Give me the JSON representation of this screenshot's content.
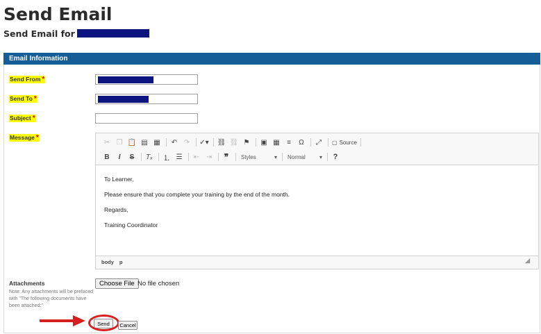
{
  "page": {
    "title": "Send Email",
    "subtitle": "Send Email for"
  },
  "panel": {
    "header": "Email Information"
  },
  "form": {
    "send_from_label": "Send From",
    "send_to_label": "Send To",
    "subject_label": "Subject",
    "message_label": "Message",
    "required_marker": "*",
    "subject_value": ""
  },
  "editor": {
    "toolbar_row1": [
      "cut-icon",
      "copy-icon",
      "paste-icon",
      "paste-text-icon",
      "paste-word-icon",
      "undo-icon",
      "redo-icon",
      "spellcheck-icon",
      "link-icon",
      "unlink-icon",
      "anchor-icon",
      "image-icon",
      "table-icon",
      "horizontal-rule-icon",
      "special-char-icon",
      "maximize-icon",
      "source-icon"
    ],
    "source_label": "Source",
    "styles_label": "Styles",
    "format_label": "Normal",
    "help_label": "?",
    "content": {
      "line1": "To Learner,",
      "line2": "Please ensure that you complete your training by the end of the month.",
      "line3": "Regards,",
      "line4": "Training Coordinator"
    },
    "status_path": [
      "body",
      "p"
    ]
  },
  "attachments": {
    "label": "Attachments",
    "note": "Note: Any attachments will be prefaced with \"The following documents have been attached:\"",
    "choose_button": "Choose File",
    "no_file_text": "No file chosen"
  },
  "actions": {
    "send_label": "Send",
    "cancel_label": "Cancel"
  },
  "colors": {
    "header_bg": "#155d96",
    "label_highlight": "#ffff00",
    "required": "#e00000",
    "annotation": "#d61f1f",
    "redaction": "#0c1580"
  }
}
